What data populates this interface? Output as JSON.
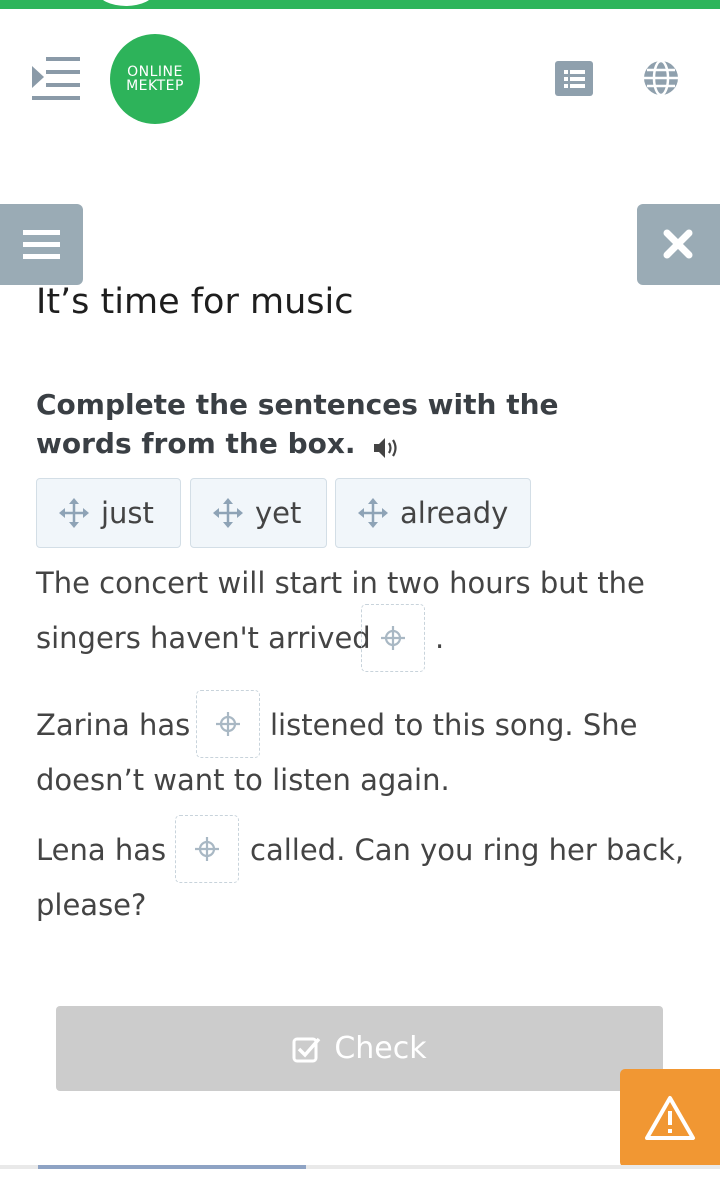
{
  "header": {
    "logo_line1": "ONLINE",
    "logo_line2": "MEKTEP",
    "icons": [
      "menu-indent-icon",
      "list-icon",
      "globe-icon"
    ],
    "accent_color": "#2eb55b"
  },
  "lesson": {
    "title": "It’s time for music",
    "instruction": "Complete the sentences with the words from the box."
  },
  "word_bank": [
    {
      "label": "just"
    },
    {
      "label": "yet"
    },
    {
      "label": "already"
    }
  ],
  "sentences": [
    {
      "line1": "The concert will start in two hours but the",
      "before": "singers haven't arrived",
      "after": "."
    },
    {
      "before": "Zarina has",
      "after": "listened to this song. She",
      "line2": "doesn’t want to listen again."
    },
    {
      "before": "Lena has",
      "after": "called. Can you ring her back,",
      "line2": "please?"
    }
  ],
  "actions": {
    "check_label": "Check",
    "check_color": "#cccccc",
    "warning_color": "#f19733"
  }
}
